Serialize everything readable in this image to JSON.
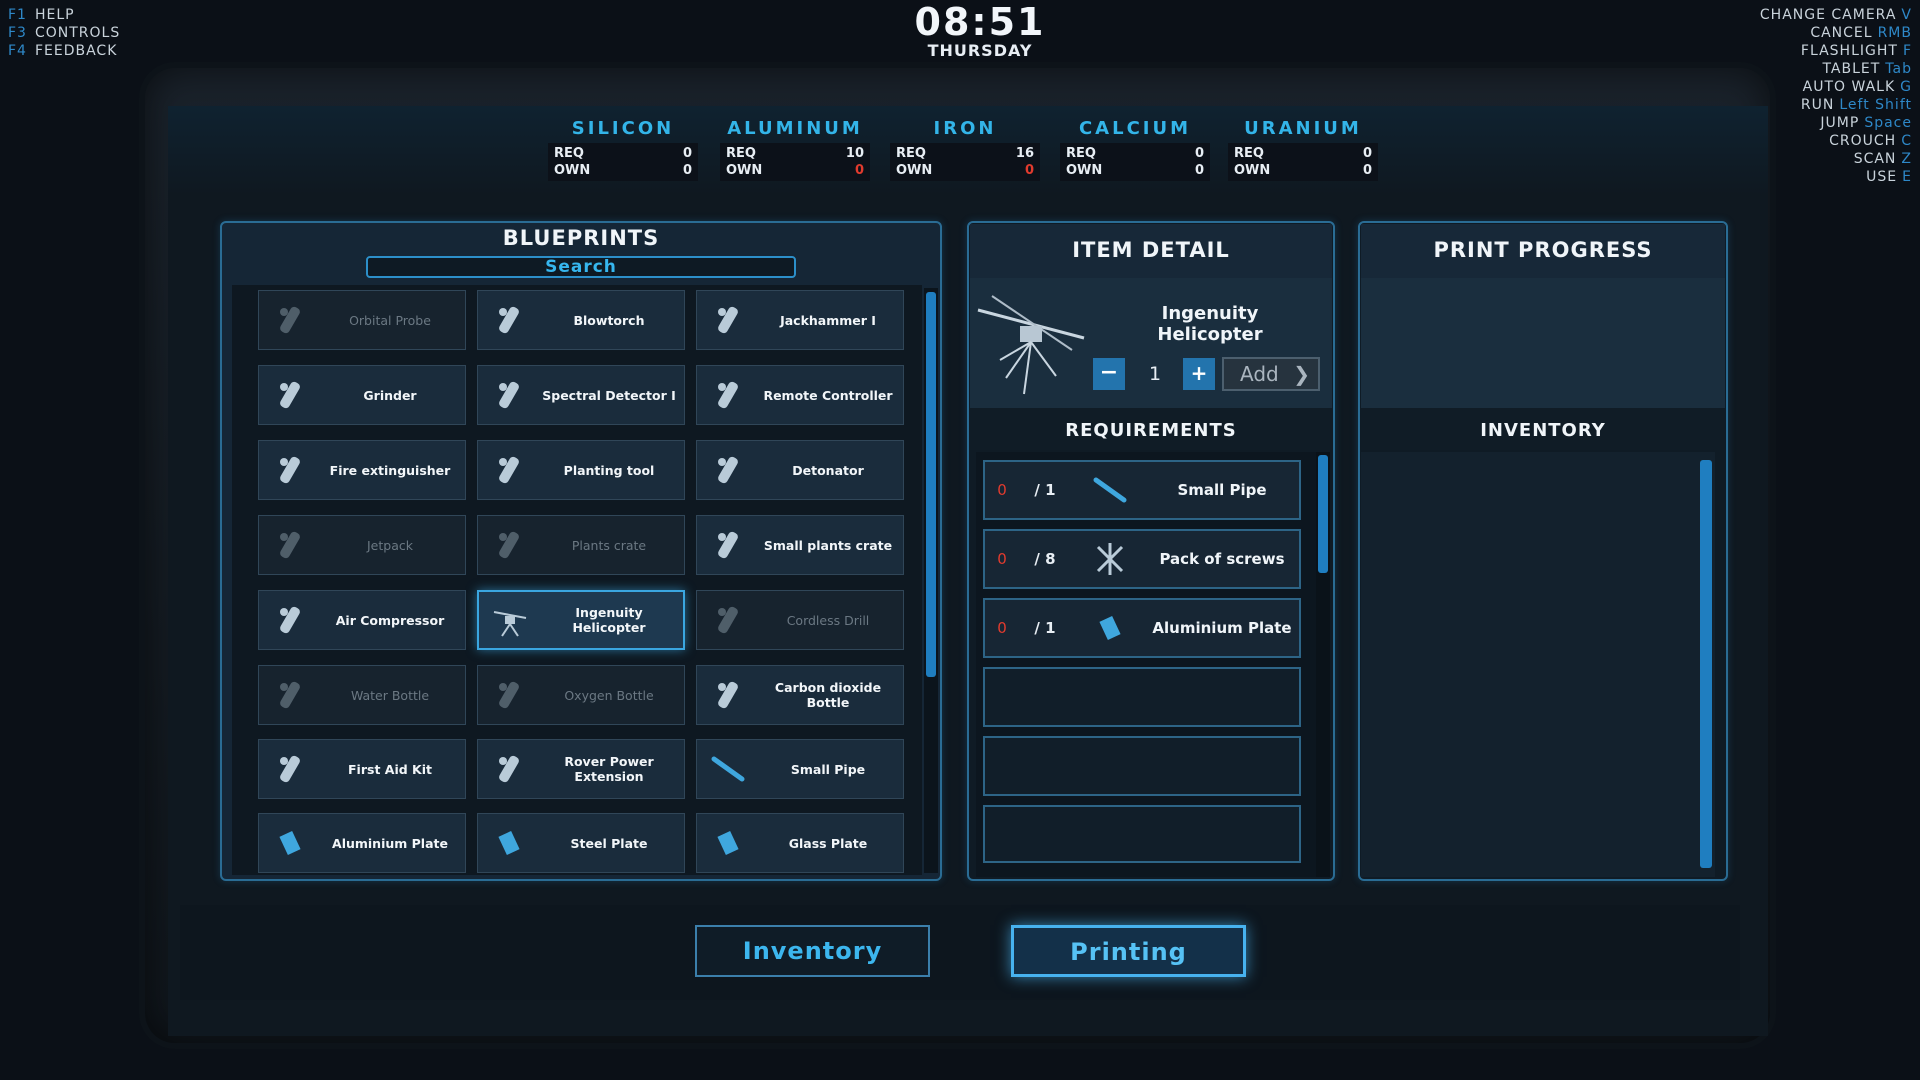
{
  "hud_left": [
    {
      "key": "F1",
      "label": "HELP"
    },
    {
      "key": "F3",
      "label": "CONTROLS"
    },
    {
      "key": "F4",
      "label": "FEEDBACK"
    }
  ],
  "clock": {
    "time": "08:51",
    "day": "THURSDAY"
  },
  "hud_right": [
    {
      "label": "CHANGE CAMERA",
      "key": "V"
    },
    {
      "label": "CANCEL",
      "key": "RMB"
    },
    {
      "label": "FLASHLIGHT",
      "key": "F"
    },
    {
      "label": "TABLET",
      "key": "Tab"
    },
    {
      "label": "AUTO WALK",
      "key": "G"
    },
    {
      "label": "RUN",
      "key": "Left Shift"
    },
    {
      "label": "JUMP",
      "key": "Space"
    },
    {
      "label": "CROUCH",
      "key": "C"
    },
    {
      "label": "SCAN",
      "key": "Z"
    },
    {
      "label": "USE",
      "key": "E"
    }
  ],
  "resources": [
    {
      "name": "SILICON",
      "req_label": "REQ",
      "req": "0",
      "own_label": "OWN",
      "own": "0",
      "own_short": false
    },
    {
      "name": "ALUMINUM",
      "req_label": "REQ",
      "req": "10",
      "own_label": "OWN",
      "own": "0",
      "own_short": true
    },
    {
      "name": "IRON",
      "req_label": "REQ",
      "req": "16",
      "own_label": "OWN",
      "own": "0",
      "own_short": true
    },
    {
      "name": "CALCIUM",
      "req_label": "REQ",
      "req": "0",
      "own_label": "OWN",
      "own": "0",
      "own_short": false
    },
    {
      "name": "URANIUM",
      "req_label": "REQ",
      "req": "0",
      "own_label": "OWN",
      "own": "0",
      "own_short": false
    }
  ],
  "blueprints": {
    "title": "BLUEPRINTS",
    "search_label": "Search",
    "items": [
      {
        "label": "Orbital Probe",
        "icon": "probe-icon",
        "available": false,
        "selected": false
      },
      {
        "label": "Blowtorch",
        "icon": "blowtorch-icon",
        "available": true,
        "selected": false
      },
      {
        "label": "Jackhammer I",
        "icon": "jackhammer-icon",
        "available": true,
        "selected": false
      },
      {
        "label": "Grinder",
        "icon": "grinder-icon",
        "available": true,
        "selected": false
      },
      {
        "label": "Spectral Detector I",
        "icon": "detector-icon",
        "available": true,
        "selected": false
      },
      {
        "label": "Remote Controller",
        "icon": "remote-icon",
        "available": true,
        "selected": false
      },
      {
        "label": "Fire extinguisher",
        "icon": "extinguisher-icon",
        "available": true,
        "selected": false
      },
      {
        "label": "Planting tool",
        "icon": "planting-tool-icon",
        "available": true,
        "selected": false
      },
      {
        "label": "Detonator",
        "icon": "detonator-icon",
        "available": true,
        "selected": false
      },
      {
        "label": "Jetpack",
        "icon": "jetpack-icon",
        "available": false,
        "selected": false
      },
      {
        "label": "Plants crate",
        "icon": "crate-icon",
        "available": false,
        "selected": false
      },
      {
        "label": "Small plants crate",
        "icon": "small-crate-icon",
        "available": true,
        "selected": false
      },
      {
        "label": "Air Compressor",
        "icon": "compressor-icon",
        "available": true,
        "selected": false
      },
      {
        "label": "Ingenuity Helicopter",
        "icon": "helicopter-icon",
        "available": true,
        "selected": true
      },
      {
        "label": "Cordless Drill",
        "icon": "drill-icon",
        "available": false,
        "selected": false
      },
      {
        "label": "Water Bottle",
        "icon": "water-bottle-icon",
        "available": false,
        "selected": false
      },
      {
        "label": "Oxygen Bottle",
        "icon": "oxygen-bottle-icon",
        "available": false,
        "selected": false
      },
      {
        "label": "Carbon dioxide Bottle",
        "icon": "co2-bottle-icon",
        "available": true,
        "selected": false
      },
      {
        "label": "First Aid Kit",
        "icon": "first-aid-icon",
        "available": true,
        "selected": false
      },
      {
        "label": "Rover Power Extension",
        "icon": "power-extension-icon",
        "available": true,
        "selected": false
      },
      {
        "label": "Small Pipe",
        "icon": "pipe-icon",
        "available": true,
        "selected": false
      },
      {
        "label": "Aluminium Plate",
        "icon": "plate-icon",
        "available": true,
        "selected": false
      },
      {
        "label": "Steel Plate",
        "icon": "plate-icon",
        "available": true,
        "selected": false
      },
      {
        "label": "Glass Plate",
        "icon": "plate-icon",
        "available": true,
        "selected": false
      }
    ]
  },
  "item_detail": {
    "title": "ITEM DETAIL",
    "name": "Ingenuity Helicopter",
    "minus_label": "−",
    "quantity": "1",
    "plus_label": "+",
    "add_label": "Add",
    "add_arrow": "❯",
    "requirements_title": "REQUIREMENTS",
    "requirements": [
      {
        "have": "0",
        "need": "/ 1",
        "name": "Small Pipe",
        "icon": "pipe-icon"
      },
      {
        "have": "0",
        "need": "/ 8",
        "name": "Pack of screws",
        "icon": "screws-icon"
      },
      {
        "have": "0",
        "need": "/ 1",
        "name": "Aluminium Plate",
        "icon": "plate-icon"
      }
    ]
  },
  "print_progress": {
    "title": "PRINT PROGRESS",
    "inventory_title": "INVENTORY"
  },
  "bottom": {
    "inventory_label": "Inventory",
    "printing_label": "Printing"
  },
  "colors": {
    "accent": "#33b4e8",
    "warning": "#e23b2e",
    "panel_border": "#2a6c94"
  }
}
